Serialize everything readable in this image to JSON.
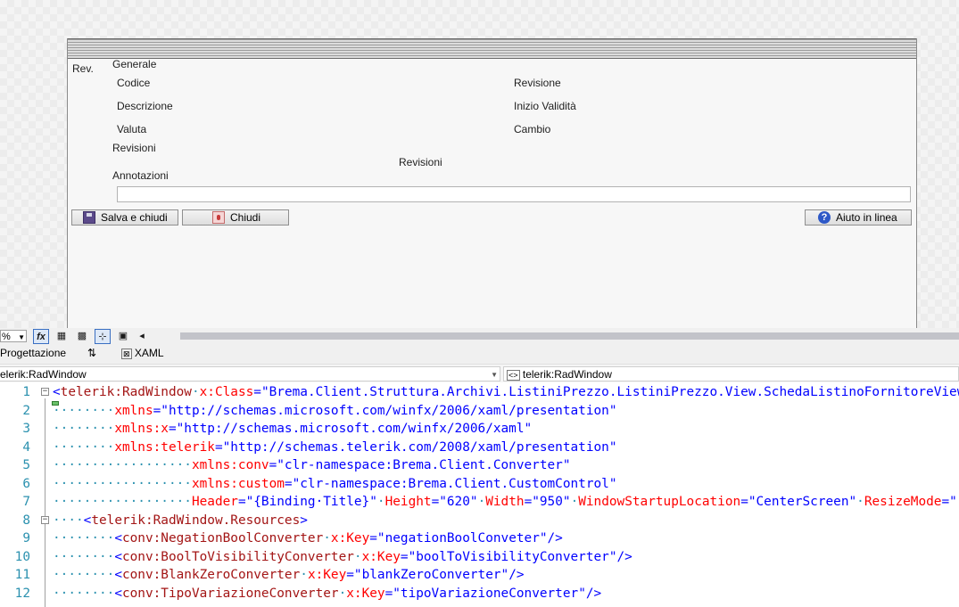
{
  "form": {
    "rev_label": "Rev.",
    "generale_label": "Generale",
    "codice_label": "Codice",
    "descrizione_label": "Descrizione",
    "valuta_label": "Valuta",
    "revisione_label": "Revisione",
    "inizio_validita_label": "Inizio Validità",
    "cambio_label": "Cambio",
    "revisioni_label": "Revisioni",
    "revisioni_header": "Revisioni",
    "annotazioni_label": "Annotazioni",
    "annotazioni_value": "",
    "save_button": "Salva e chiudi",
    "close_button": "Chiudi",
    "help_button": "Aiuto in linea"
  },
  "toolbar": {
    "zoom_value": "%",
    "fx_label": "fx"
  },
  "tabs": {
    "design": "Progettazione",
    "swap": "⇅",
    "xaml": "XAML"
  },
  "nav": {
    "left_selected": "elerik:RadWindow",
    "right_selected": "telerik:RadWindow"
  },
  "code": {
    "line_numbers": [
      "1",
      "2",
      "3",
      "4",
      "5",
      "6",
      "7",
      "8",
      "9",
      "10",
      "11",
      "12"
    ],
    "lines": [
      [
        {
          "t": "br",
          "v": "<"
        },
        {
          "t": "tag",
          "v": "telerik:RadWindow"
        },
        {
          "t": "ws",
          "v": "·"
        },
        {
          "t": "attr",
          "v": "x:Class"
        },
        {
          "t": "br",
          "v": "=\""
        },
        {
          "t": "val",
          "v": "Brema.Client.Struttura.Archivi.ListiniPrezzo.ListiniPrezzo.View.SchedaListinoFornitoreView"
        }
      ],
      [
        {
          "t": "ws",
          "v": "········"
        },
        {
          "t": "attr",
          "v": "xmlns"
        },
        {
          "t": "br",
          "v": "=\""
        },
        {
          "t": "val",
          "v": "http://schemas.microsoft.com/winfx/2006/xaml/presentation"
        },
        {
          "t": "br",
          "v": "\""
        }
      ],
      [
        {
          "t": "ws",
          "v": "········"
        },
        {
          "t": "attr",
          "v": "xmlns:x"
        },
        {
          "t": "br",
          "v": "=\""
        },
        {
          "t": "val",
          "v": "http://schemas.microsoft.com/winfx/2006/xaml"
        },
        {
          "t": "br",
          "v": "\""
        }
      ],
      [
        {
          "t": "ws",
          "v": "········"
        },
        {
          "t": "attr",
          "v": "xmlns:telerik"
        },
        {
          "t": "br",
          "v": "=\""
        },
        {
          "t": "val",
          "v": "http://schemas.telerik.com/2008/xaml/presentation"
        },
        {
          "t": "br",
          "v": "\""
        }
      ],
      [
        {
          "t": "ws",
          "v": "··················"
        },
        {
          "t": "attr",
          "v": "xmlns:conv"
        },
        {
          "t": "br",
          "v": "=\""
        },
        {
          "t": "val",
          "v": "clr-namespace:Brema.Client.Converter"
        },
        {
          "t": "br",
          "v": "\""
        }
      ],
      [
        {
          "t": "ws",
          "v": "··················"
        },
        {
          "t": "attr",
          "v": "xmlns:custom"
        },
        {
          "t": "br",
          "v": "=\""
        },
        {
          "t": "val",
          "v": "clr-namespace:Brema.Client.CustomControl"
        },
        {
          "t": "br",
          "v": "\""
        }
      ],
      [
        {
          "t": "ws",
          "v": "··················"
        },
        {
          "t": "attr",
          "v": "Header"
        },
        {
          "t": "br",
          "v": "=\""
        },
        {
          "t": "val",
          "v": "{Binding·Title}"
        },
        {
          "t": "br",
          "v": "\""
        },
        {
          "t": "ws",
          "v": "·"
        },
        {
          "t": "attr",
          "v": "Height"
        },
        {
          "t": "br",
          "v": "=\""
        },
        {
          "t": "val",
          "v": "620"
        },
        {
          "t": "br",
          "v": "\""
        },
        {
          "t": "ws",
          "v": "·"
        },
        {
          "t": "attr",
          "v": "Width"
        },
        {
          "t": "br",
          "v": "=\""
        },
        {
          "t": "val",
          "v": "950"
        },
        {
          "t": "br",
          "v": "\""
        },
        {
          "t": "ws",
          "v": "·"
        },
        {
          "t": "attr",
          "v": "WindowStartupLocation"
        },
        {
          "t": "br",
          "v": "=\""
        },
        {
          "t": "val",
          "v": "CenterScreen"
        },
        {
          "t": "br",
          "v": "\""
        },
        {
          "t": "ws",
          "v": "·"
        },
        {
          "t": "attr",
          "v": "ResizeMode"
        },
        {
          "t": "br",
          "v": "=\""
        }
      ],
      [
        {
          "t": "ws",
          "v": "····"
        },
        {
          "t": "br",
          "v": "<"
        },
        {
          "t": "tag",
          "v": "telerik:RadWindow.Resources"
        },
        {
          "t": "br",
          "v": ">"
        }
      ],
      [
        {
          "t": "ws",
          "v": "········"
        },
        {
          "t": "br",
          "v": "<"
        },
        {
          "t": "tag",
          "v": "conv:NegationBoolConverter"
        },
        {
          "t": "ws",
          "v": "·"
        },
        {
          "t": "attr",
          "v": "x:Key"
        },
        {
          "t": "br",
          "v": "=\""
        },
        {
          "t": "val",
          "v": "negationBoolConveter"
        },
        {
          "t": "br",
          "v": "\"/>"
        }
      ],
      [
        {
          "t": "ws",
          "v": "········"
        },
        {
          "t": "br",
          "v": "<"
        },
        {
          "t": "tag",
          "v": "conv:BoolToVisibilityConverter"
        },
        {
          "t": "ws",
          "v": "·"
        },
        {
          "t": "attr",
          "v": "x:Key"
        },
        {
          "t": "br",
          "v": "=\""
        },
        {
          "t": "val",
          "v": "boolToVisibilityConverter"
        },
        {
          "t": "br",
          "v": "\"/>"
        }
      ],
      [
        {
          "t": "ws",
          "v": "········"
        },
        {
          "t": "br",
          "v": "<"
        },
        {
          "t": "tag",
          "v": "conv:BlankZeroConverter"
        },
        {
          "t": "ws",
          "v": "·"
        },
        {
          "t": "attr",
          "v": "x:Key"
        },
        {
          "t": "br",
          "v": "=\""
        },
        {
          "t": "val",
          "v": "blankZeroConverter"
        },
        {
          "t": "br",
          "v": "\"/>"
        }
      ],
      [
        {
          "t": "ws",
          "v": "········"
        },
        {
          "t": "br",
          "v": "<"
        },
        {
          "t": "tag",
          "v": "conv:TipoVariazioneConverter"
        },
        {
          "t": "ws",
          "v": "·"
        },
        {
          "t": "attr",
          "v": "x:Key"
        },
        {
          "t": "br",
          "v": "=\""
        },
        {
          "t": "val",
          "v": "tipoVariazioneConverter"
        },
        {
          "t": "br",
          "v": "\"/>"
        }
      ]
    ]
  },
  "colors": {
    "tag": "#a31515",
    "attribute": "#ff0000",
    "value": "#0000ff",
    "whitespace": "#2b91af",
    "line_number": "#2b91af"
  },
  "icons": {
    "save": "floppy-disk-icon",
    "close": "close-door-icon",
    "help": "question-mark-icon"
  }
}
